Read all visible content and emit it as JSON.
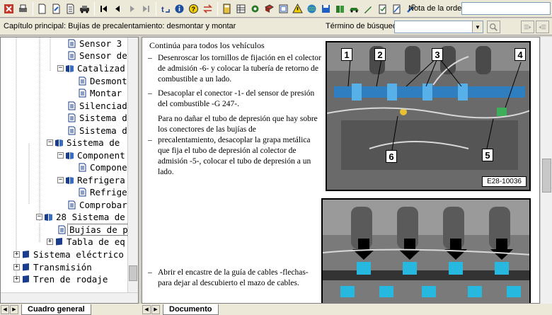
{
  "toolbar": {
    "order_label": "Nota de la orden:",
    "order_value": ""
  },
  "chapter_bar": {
    "chapter": "Capítulo principal: Bujías de precalentamiento: desmontar y montar",
    "search_label": "Término de búsqueda:",
    "search_value": ""
  },
  "tree": {
    "items": [
      {
        "label": "Sensor 3"
      },
      {
        "label": "Sensor de"
      },
      {
        "label": "Catalizad"
      },
      {
        "label": "Desmont"
      },
      {
        "label": "Montar"
      },
      {
        "label": "Silenciad"
      },
      {
        "label": "Sistema d"
      },
      {
        "label": "Sistema d"
      },
      {
        "label": "Sistema de"
      },
      {
        "label": "Component"
      },
      {
        "label": "Compone"
      },
      {
        "label": "Refrigera"
      },
      {
        "label": "Refrige"
      },
      {
        "label": "Comprobar"
      },
      {
        "label": "28 Sistema de"
      },
      {
        "label": "Bujías de p"
      },
      {
        "label": "Tabla de eq"
      },
      {
        "label": "Sistema eléctrico"
      },
      {
        "label": "Transmisión"
      },
      {
        "label": "Tren de rodaje"
      }
    ]
  },
  "tabs": {
    "left": "Cuadro general",
    "right": "Documento"
  },
  "document": {
    "title": "Continúa para todos los vehículos",
    "steps": [
      "Desenroscar los tornillos de fijación en el colector de admisión -6- y colocar la tubería de retorno de combustible a un lado.",
      "Desacoplar el conector -1- del sensor de presión del combustible -G 247-.",
      "precalentamiento, desacoplar la grapa metálica que fija el tubo de depresión al colector de admisión -5-, colocar el tubo de depresión a un lado.",
      "Abrir el encastre de la guía de cables -flechas- para dejar al descubierto el mazo de cables."
    ],
    "note": "Para no dañar el tubo de depresión que hay sobre los conectores de las bujías de",
    "figure1": {
      "code": "E28-10036",
      "callouts": [
        "1",
        "2",
        "3",
        "4",
        "5",
        "6"
      ]
    }
  }
}
